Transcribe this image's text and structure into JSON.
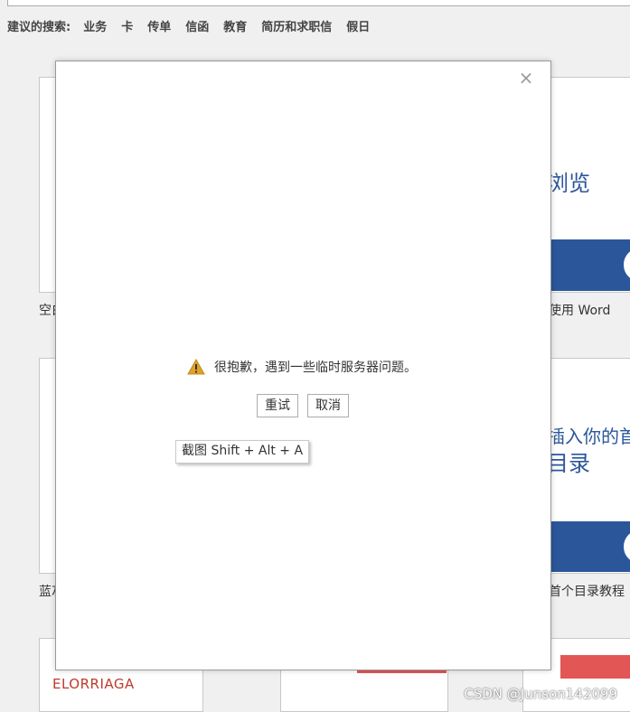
{
  "suggestions": {
    "label": "建议的搜索:",
    "items": [
      "业务",
      "卡",
      "传单",
      "信函",
      "教育",
      "简历和求职信",
      "假日"
    ]
  },
  "background": {
    "card_top_left_label": "空白",
    "card_top_right_label": "使用 Word",
    "card_top_right_text": "浏览",
    "card_mid_left_label": "蓝灰",
    "card_mid_right_label": "首个目录教程",
    "card_mid_right_text1": "插入你的首个",
    "card_mid_right_text2": "目录",
    "card_bottom_left_title": "ELORRIAGA"
  },
  "dialog": {
    "message": "很抱歉，遇到一些临时服务器问题。",
    "retry_button": "重试",
    "cancel_button": "取消",
    "close_glyph": "×"
  },
  "tooltip": {
    "text": "截图 Shift + Alt + A"
  },
  "watermark": "CSDN @Junson142099",
  "colors": {
    "word_blue": "#2b579a",
    "warning": "#e0a12b",
    "accent_red": "#e35656"
  }
}
